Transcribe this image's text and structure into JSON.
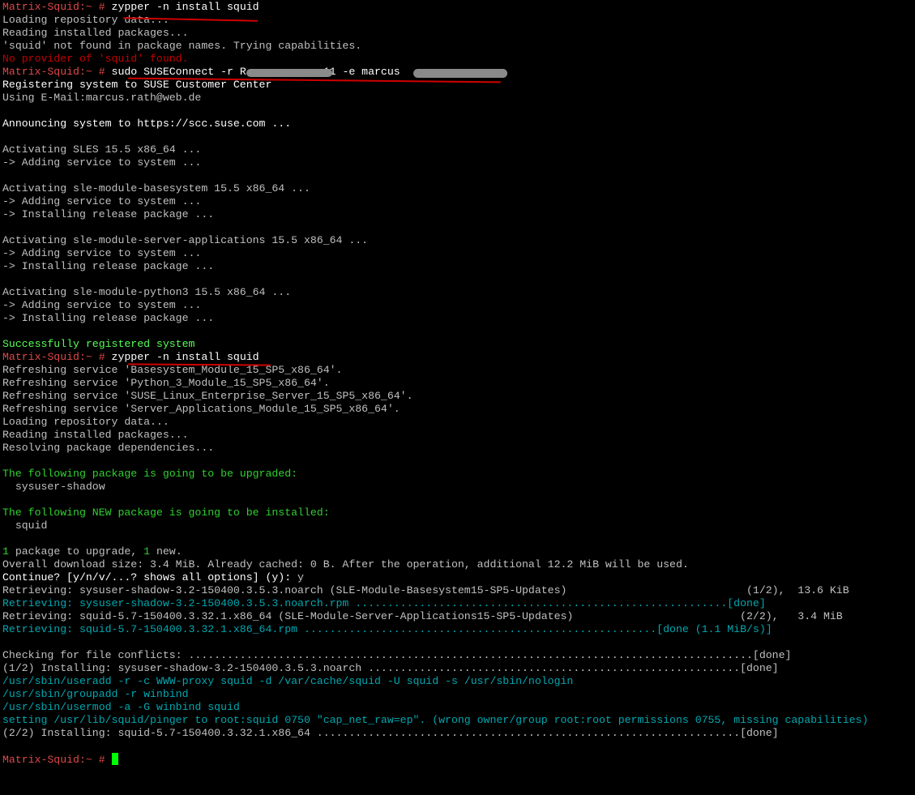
{
  "prompt": "Matrix-Squid:~ # ",
  "colors": {
    "background": "#000000",
    "text": "#c0c0c0",
    "prompt": "#e04848",
    "error": "#c00000",
    "success": "#55ff55",
    "heading": "#2fd02f",
    "retrieving": "#00a8b0",
    "cursor": "#00ff00"
  },
  "lines": [
    [
      {
        "t": "Matrix-Squid:~ # ",
        "c": "pred"
      },
      {
        "t": "zypper -n install squid",
        "c": "white"
      }
    ],
    [
      {
        "t": "Loading repository data...",
        "c": "gray"
      }
    ],
    [
      {
        "t": "Reading installed packages...",
        "c": "gray"
      }
    ],
    [
      {
        "t": "'squid' not found in package names. Trying capabilities.",
        "c": "gray"
      }
    ],
    [
      {
        "t": "No provider of 'squid' found.",
        "c": "red"
      }
    ],
    [
      {
        "t": "Matrix-Squid:~ # ",
        "c": "pred"
      },
      {
        "t": "sudo SUSEConnect -r R            11 -e marcus",
        "c": "white"
      }
    ],
    [
      {
        "t": "Registering system to SUSE Customer Center",
        "c": "white"
      }
    ],
    [
      {
        "t": "Using E-Mail:marcus.rath@web.de",
        "c": "gray"
      }
    ],
    [
      {
        "t": "",
        "c": "gray"
      }
    ],
    [
      {
        "t": "Announcing system to https://scc.suse.com ...",
        "c": "white"
      }
    ],
    [
      {
        "t": "",
        "c": "gray"
      }
    ],
    [
      {
        "t": "Activating SLES 15.5 x86_64 ...",
        "c": "gray"
      }
    ],
    [
      {
        "t": "-> Adding service to system ...",
        "c": "gray"
      }
    ],
    [
      {
        "t": "",
        "c": "gray"
      }
    ],
    [
      {
        "t": "Activating sle-module-basesystem 15.5 x86_64 ...",
        "c": "gray"
      }
    ],
    [
      {
        "t": "-> Adding service to system ...",
        "c": "gray"
      }
    ],
    [
      {
        "t": "-> Installing release package ...",
        "c": "gray"
      }
    ],
    [
      {
        "t": "",
        "c": "gray"
      }
    ],
    [
      {
        "t": "Activating sle-module-server-applications 15.5 x86_64 ...",
        "c": "gray"
      }
    ],
    [
      {
        "t": "-> Adding service to system ...",
        "c": "gray"
      }
    ],
    [
      {
        "t": "-> Installing release package ...",
        "c": "gray"
      }
    ],
    [
      {
        "t": "",
        "c": "gray"
      }
    ],
    [
      {
        "t": "Activating sle-module-python3 15.5 x86_64 ...",
        "c": "gray"
      }
    ],
    [
      {
        "t": "-> Adding service to system ...",
        "c": "gray"
      }
    ],
    [
      {
        "t": "-> Installing release package ...",
        "c": "gray"
      }
    ],
    [
      {
        "t": "",
        "c": "gray"
      }
    ],
    [
      {
        "t": "Successfully registered system",
        "c": "lgreen"
      }
    ],
    [
      {
        "t": "Matrix-Squid:~ # ",
        "c": "pred"
      },
      {
        "t": "zypper -n install squid",
        "c": "white"
      }
    ],
    [
      {
        "t": "Refreshing service 'Basesystem_Module_15_SP5_x86_64'.",
        "c": "gray"
      }
    ],
    [
      {
        "t": "Refreshing service 'Python_3_Module_15_SP5_x86_64'.",
        "c": "gray"
      }
    ],
    [
      {
        "t": "Refreshing service 'SUSE_Linux_Enterprise_Server_15_SP5_x86_64'.",
        "c": "gray"
      }
    ],
    [
      {
        "t": "Refreshing service 'Server_Applications_Module_15_SP5_x86_64'.",
        "c": "gray"
      }
    ],
    [
      {
        "t": "Loading repository data...",
        "c": "gray"
      }
    ],
    [
      {
        "t": "Reading installed packages...",
        "c": "gray"
      }
    ],
    [
      {
        "t": "Resolving package dependencies...",
        "c": "gray"
      }
    ],
    [
      {
        "t": "",
        "c": "gray"
      }
    ],
    [
      {
        "t": "The following package is going to be upgraded:",
        "c": "green"
      }
    ],
    [
      {
        "t": "  sysuser-shadow",
        "c": "gray"
      }
    ],
    [
      {
        "t": "",
        "c": "gray"
      }
    ],
    [
      {
        "t": "The following NEW package is going to be installed:",
        "c": "green"
      }
    ],
    [
      {
        "t": "  squid",
        "c": "gray"
      }
    ],
    [
      {
        "t": "",
        "c": "gray"
      }
    ],
    [
      {
        "t": "1",
        "c": "green"
      },
      {
        "t": " package to upgrade, ",
        "c": "gray"
      },
      {
        "t": "1",
        "c": "green"
      },
      {
        "t": " new.",
        "c": "gray"
      }
    ],
    [
      {
        "t": "Overall download size: 3.4 MiB. Already cached: 0 B. After the operation, additional 12.2 MiB will be used.",
        "c": "gray"
      }
    ],
    [
      {
        "t": "Continue? [y/n/v/...? shows all options] (y): ",
        "c": "white"
      },
      {
        "t": "y",
        "c": "gray"
      }
    ],
    [
      {
        "t": "Retrieving: sysuser-shadow-3.2-150400.3.5.3.noarch (SLE-Module-Basesystem15-SP5-Updates)                            (1/2),  13.6 KiB",
        "c": "gray"
      }
    ],
    [
      {
        "t": "Retrieving: sysuser-shadow-3.2-150400.3.5.3.noarch.rpm ..........................................................[done]",
        "c": "cyan"
      }
    ],
    [
      {
        "t": "Retrieving: squid-5.7-150400.3.32.1.x86_64 (SLE-Module-Server-Applications15-SP5-Updates)                          (2/2),   3.4 MiB",
        "c": "gray"
      }
    ],
    [
      {
        "t": "Retrieving: squid-5.7-150400.3.32.1.x86_64.rpm .......................................................[done (1.1 MiB/s)]",
        "c": "cyan"
      }
    ],
    [
      {
        "t": "",
        "c": "gray"
      }
    ],
    [
      {
        "t": "Checking for file conflicts: ........................................................................................[done]",
        "c": "gray"
      }
    ],
    [
      {
        "t": "(1/2) Installing: sysuser-shadow-3.2-150400.3.5.3.noarch ..........................................................[done]",
        "c": "gray"
      }
    ],
    [
      {
        "t": "/usr/sbin/useradd -r -c WWW-proxy squid -d /var/cache/squid -U squid -s /usr/sbin/nologin",
        "c": "cyan"
      }
    ],
    [
      {
        "t": "/usr/sbin/groupadd -r winbind",
        "c": "cyan"
      }
    ],
    [
      {
        "t": "/usr/sbin/usermod -a -G winbind squid",
        "c": "cyan"
      }
    ],
    [
      {
        "t": "setting /usr/lib/squid/pinger to root:squid 0750 \"cap_net_raw=ep\". (wrong owner/group root:root permissions 0755, missing capabilities)",
        "c": "cyan"
      }
    ],
    [
      {
        "t": "(2/2) Installing: squid-5.7-150400.3.32.1.x86_64 ..................................................................[done]",
        "c": "gray"
      }
    ],
    [
      {
        "t": "",
        "c": "gray"
      }
    ],
    [
      {
        "t": "Matrix-Squid:~ # ",
        "c": "pred"
      }
    ]
  ]
}
